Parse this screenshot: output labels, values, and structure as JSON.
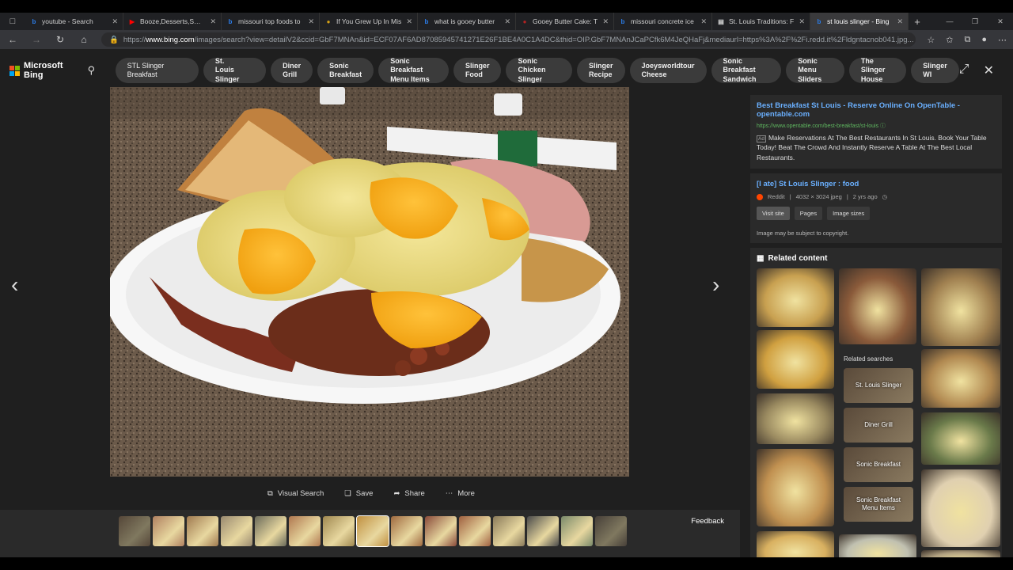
{
  "browser": {
    "tabs": [
      {
        "title": "youtube - Search",
        "icon": "bing",
        "color": "#2b7de9"
      },
      {
        "title": "Booze,Desserts,Smoke",
        "icon": "youtube",
        "color": "#ff0000"
      },
      {
        "title": "missouri top foods to",
        "icon": "bing",
        "color": "#2b7de9"
      },
      {
        "title": "If You Grew Up In Mis",
        "icon": "site",
        "color": "#d4a017"
      },
      {
        "title": "what is gooey butter",
        "icon": "bing",
        "color": "#2b7de9"
      },
      {
        "title": "Gooey Butter Cake: T",
        "icon": "site",
        "color": "#b22222"
      },
      {
        "title": "missouri concrete ice",
        "icon": "bing",
        "color": "#2b7de9"
      },
      {
        "title": "St. Louis Traditions: F",
        "icon": "doc",
        "color": "#dddddd"
      },
      {
        "title": "st louis slinger - Bing",
        "icon": "bing",
        "color": "#2b7de9",
        "active": true
      }
    ],
    "url_prefix": "https://",
    "url_domain": "www.bing.com",
    "url_rest": "/images/search?view=detailV2&ccid=GbF7MNAn&id=ECF07AF6AD87085945741271E26F1BE4A0C1A4DC&thid=OIP.GbF7MNAnJCaPCfk6M4JeQHaFj&mediaurl=https%3A%2F%2Fi.redd.it%2Fldgntacnob041.jpg..."
  },
  "bing": {
    "logo_text": "Microsoft Bing",
    "chips": [
      [
        "STL Slinger Breakfast"
      ],
      [
        "St.",
        "Louis Slinger"
      ],
      [
        "Diner",
        "Grill"
      ],
      [
        "Sonic",
        "Breakfast"
      ],
      [
        "Sonic Breakfast",
        "Menu Items"
      ],
      [
        "Slinger",
        "Food"
      ],
      [
        "Sonic Chicken",
        "Slinger"
      ],
      [
        "Slinger",
        "Recipe"
      ],
      [
        "Joeysworldtour",
        "Cheese"
      ],
      [
        "Sonic Breakfast",
        "Sandwich"
      ],
      [
        "Sonic Menu",
        "Sliders"
      ],
      [
        "The Slinger",
        "House"
      ],
      [
        "Slinger",
        "WI"
      ]
    ]
  },
  "viewer": {
    "actions": {
      "visual_search": "Visual Search",
      "save": "Save",
      "share": "Share",
      "more": "More"
    },
    "feedback": "Feedback"
  },
  "panel": {
    "ad": {
      "title": "Best Breakfast St Louis - Reserve Online On OpenTable - opentable.com",
      "url": "https://www.opentable.com/best-breakfast/st-louis",
      "badge": "Ad",
      "text": "Make Reservations At The Best Restaurants In St Louis. Book Your Table Today! Beat The Crowd And Instantly Reserve A Table At The Best Local Restaurants."
    },
    "result": {
      "title": "[I ate] St Louis Slinger : food",
      "source": "Reddit",
      "size": "4032 × 3024 jpeg",
      "age": "2 yrs ago",
      "buttons": [
        "Visit site",
        "Pages",
        "Image sizes"
      ],
      "copyright": "Image may be subject to copyright."
    },
    "related": {
      "heading": "Related content",
      "searches_label": "Related searches",
      "searches": [
        [
          "St. Louis Slinger"
        ],
        [
          "Diner Grill"
        ],
        [
          "Sonic Breakfast"
        ],
        [
          "Sonic Breakfast",
          "Menu Items"
        ]
      ]
    }
  }
}
